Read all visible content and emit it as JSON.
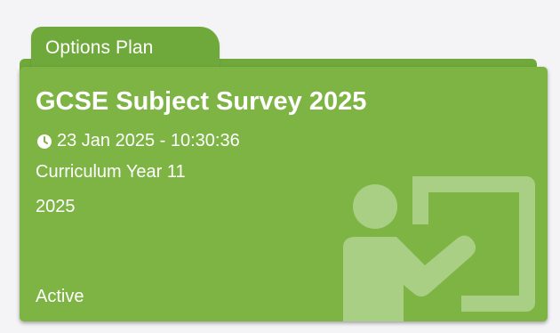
{
  "folder": {
    "tab_label": "Options Plan"
  },
  "card": {
    "title": "GCSE Subject Survey 2025",
    "datetime": "23 Jan 2025 - 10:30:36",
    "line1": "Curriculum Year 11",
    "line2": "2025",
    "status": "Active"
  },
  "icons": {
    "date": "clock-icon",
    "background": "teacher-board-icon"
  },
  "colors": {
    "card_green": "#7db443",
    "tab_green": "#6fa93c",
    "background": "#f4f3f6"
  }
}
